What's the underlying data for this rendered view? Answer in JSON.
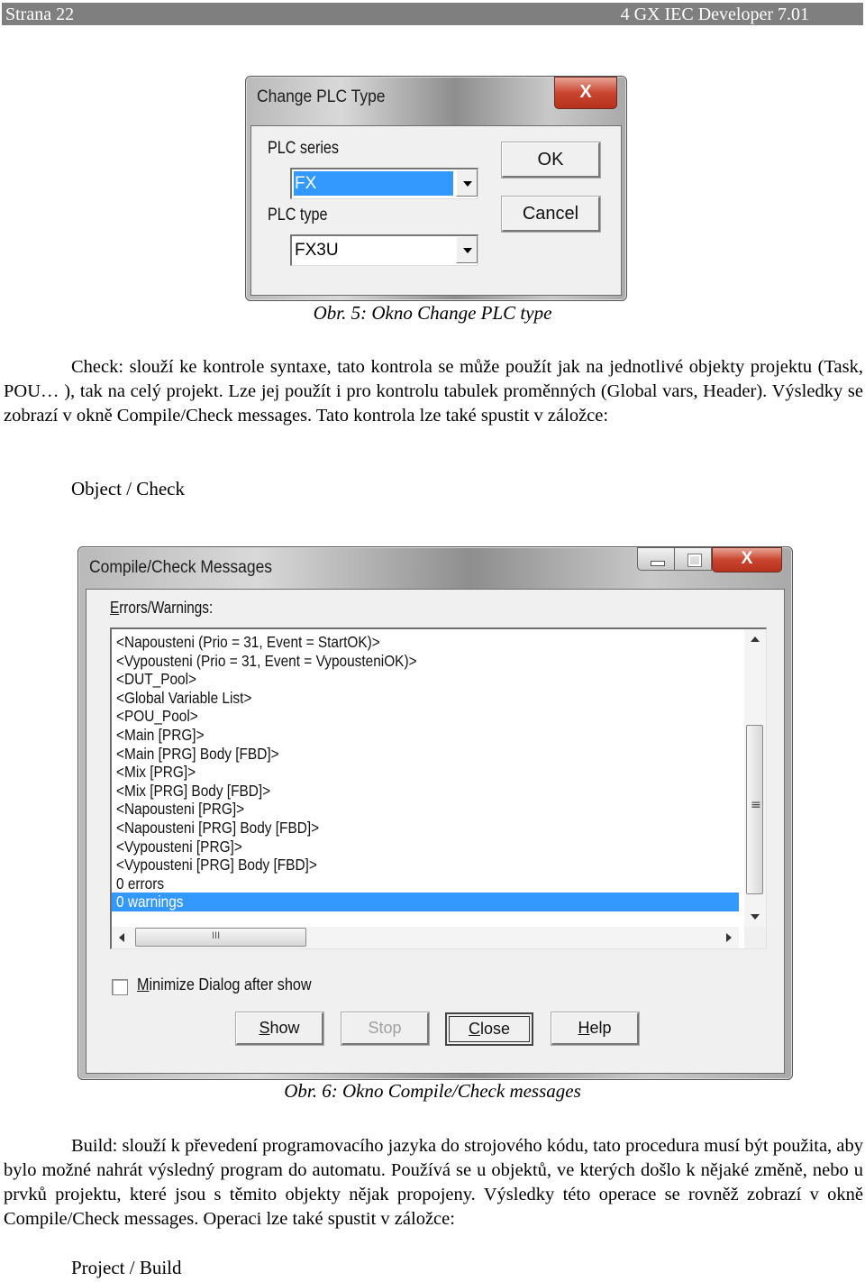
{
  "header": {
    "page_label": "Strana 22",
    "chapter": "4 GX IEC Developer 7.01"
  },
  "dialog_plc": {
    "title": "Change PLC Type",
    "close_glyph": "X",
    "series_label": "PLC series",
    "series_value": "FX",
    "type_label": "PLC type",
    "type_value": "FX3U",
    "ok_label": "OK",
    "cancel_label": "Cancel"
  },
  "caption_1": "Obr. 5: Okno Change PLC type",
  "paragraph_1": "Check: slouží ke kontrole syntaxe, tato kontrola se může použít jak na jednotlivé objekty projektu (Task, POU… ), tak na celý projekt. Lze jej použít i pro kontrolu tabulek proměnných (Global vars, Header). Výsledky se zobrazí v okně Compile/Check messages. Tato kontrola lze také spustit v záložce:",
  "menu_path_1": "Object / Check",
  "dialog_compile": {
    "title": "Compile/Check Messages",
    "close_glyph": "X",
    "list_label": "Errors/Warnings:",
    "messages": [
      "<Napousteni (Prio = 31, Event = StartOK)>",
      "<Vypousteni (Prio = 31, Event = VypousteniOK)>",
      "<DUT_Pool>",
      "<Global Variable List>",
      "<POU_Pool>",
      "<Main [PRG]>",
      "<Main [PRG] Body [FBD]>",
      "<Mix [PRG]>",
      "<Mix [PRG] Body [FBD]>",
      "<Napousteni [PRG]>",
      "<Napousteni [PRG] Body [FBD]>",
      "<Vypousteni [PRG]>",
      "<Vypousteni [PRG] Body [FBD]>",
      "0 errors",
      "0 warnings"
    ],
    "selected_index": 14,
    "minimize_checkbox_label": "Minimize  Dialog after show",
    "minimize_checked": false,
    "buttons": {
      "show": "Show",
      "stop": "Stop",
      "close": "Close",
      "help": "Help"
    }
  },
  "caption_2": "Obr. 6: Okno Compile/Check messages",
  "paragraph_2": "Build: slouží k převedení programovacího jazyka do strojového kódu, tato procedura musí být použita, aby bylo možné nahrát výsledný program do automatu. Používá se u objektů, ve kterých došlo k nějaké změně, nebo u prvků projektu, které jsou s těmito objekty nějak propojeny. Výsledky této operace se rovněž zobrazí v okně Compile/Check messages. Operaci lze také spustit v záložce:",
  "menu_path_2": "Project / Build"
}
